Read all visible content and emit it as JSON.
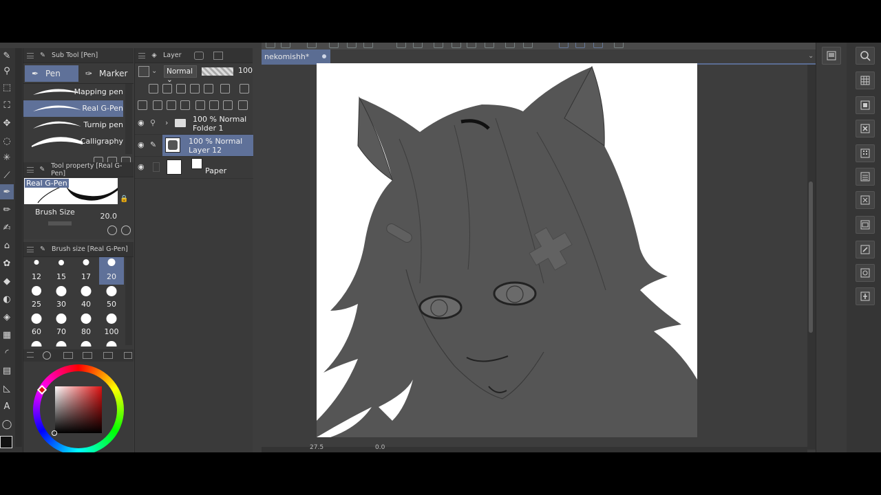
{
  "document": {
    "tab_label": "nekomishh*",
    "zoom": "27.5",
    "rotation": "0.0"
  },
  "subtool_panel": {
    "title": "Sub Tool [Pen]",
    "tabs": [
      {
        "label": "Pen",
        "icon": "pen-nib-icon",
        "active": true
      },
      {
        "label": "Marker",
        "icon": "marker-icon",
        "active": false
      }
    ],
    "brushes": [
      {
        "label": "Mapping pen",
        "active": false
      },
      {
        "label": "Real G-Pen",
        "active": true
      },
      {
        "label": "Turnip pen",
        "active": false
      },
      {
        "label": "Calligraphy",
        "active": false
      }
    ]
  },
  "tool_property": {
    "title": "Tool property [Real G-Pen]",
    "preview_label": "Real G-Pen",
    "brush_size_label": "Brush Size",
    "brush_size_value": "20.0"
  },
  "brush_size_panel": {
    "title": "Brush size [Real G-Pen]",
    "sizes": [
      "12",
      "15",
      "17",
      "20",
      "25",
      "30",
      "40",
      "50",
      "60",
      "70",
      "80",
      "100"
    ],
    "selected": "20"
  },
  "color": {
    "main": "#111111",
    "sub": "#ffffff",
    "hue": "#dd1111"
  },
  "layer_panel": {
    "title": "Layer",
    "blend_mode": "Normal",
    "opacity": "100",
    "layers": [
      {
        "line1": "100 % Normal",
        "line2": "Folder 1",
        "type": "folder",
        "active": false
      },
      {
        "line1": "100 % Normal",
        "line2": "Layer 12",
        "type": "raster",
        "active": true
      },
      {
        "line1": "",
        "line2": "Paper",
        "type": "paper",
        "active": false
      }
    ]
  },
  "theme": {
    "selection": "#5f7199",
    "panel_bg": "#3a3a3a",
    "header_bg": "#333333"
  }
}
